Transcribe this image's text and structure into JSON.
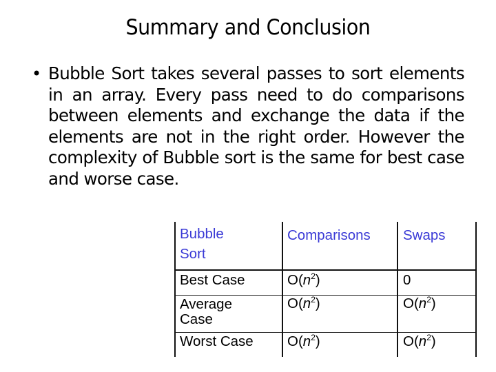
{
  "slide": {
    "title": "Summary and Conclusion",
    "bullets": [
      {
        "marker": "•",
        "text": "Bubble Sort takes several passes to sort elements in an array.  Every pass need to do comparisons between elements and exchange the data if the elements are not in the right order.  However the complexity of Bubble sort is the same for best case and worse case."
      }
    ]
  },
  "table": {
    "header_color": "#3a3ad6",
    "headers": [
      "Bubble Sort",
      "Comparisons",
      "Swaps"
    ],
    "rows": [
      {
        "case": "Best Case",
        "comparisons": "O(n²)",
        "swaps": "0"
      },
      {
        "case": "Average Case",
        "comparisons": "O(n²)",
        "swaps": "O(n²)"
      },
      {
        "case": "Worst Case",
        "comparisons": "O(n²)",
        "swaps": "O(n²)"
      }
    ]
  }
}
